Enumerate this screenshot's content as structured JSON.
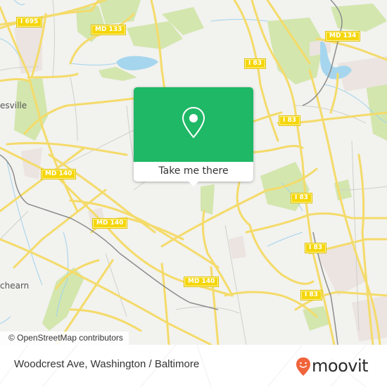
{
  "map": {
    "shields": [
      {
        "label": "I 695"
      },
      {
        "label": "MD 133"
      },
      {
        "label": "MD 134"
      },
      {
        "label": "I 83"
      },
      {
        "label": "I 83"
      },
      {
        "label": "MD 140"
      },
      {
        "label": "I 83"
      },
      {
        "label": "MD 140"
      },
      {
        "label": "I 83"
      },
      {
        "label": "MD 140"
      },
      {
        "label": "I 83"
      }
    ],
    "places": [
      {
        "label": "esville"
      },
      {
        "label": "chearn"
      }
    ],
    "attribution": "© OpenStreetMap contributors",
    "colors": {
      "background": "#f2f2ef",
      "road": "#f7df6b",
      "park": "#cfe3a8",
      "water": "#9fd3ec",
      "railway": "#888888",
      "shield": "#f5d60a"
    }
  },
  "popup": {
    "icon": "location-pin-icon",
    "cta_label": "Take me there",
    "color": "#1fb866"
  },
  "footer": {
    "address": "Woodcrest Ave, Washington / Baltimore",
    "brand": "moovit",
    "brand_color": "#f0643c"
  }
}
